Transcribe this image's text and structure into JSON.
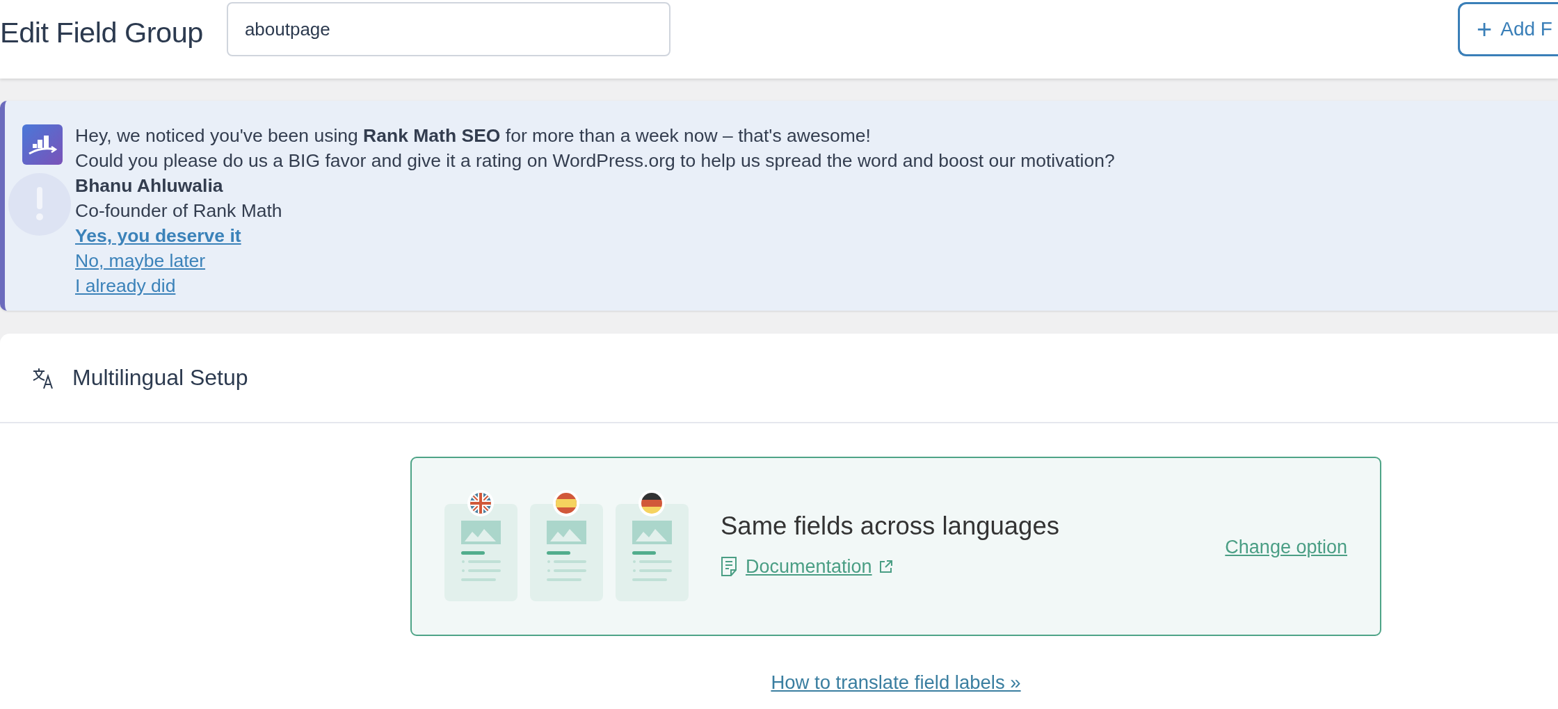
{
  "header": {
    "title": "Edit Field Group",
    "title_field": {
      "value": "aboutpage"
    },
    "add_button": {
      "icon": "+",
      "label": "Add F"
    }
  },
  "notice": {
    "lines": [
      "Hey, we noticed you've been using **Rank Math SEO** for more than a week now – that's awesome!",
      "Could you please do us a BIG favor and give it a rating on WordPress.org to help us spread the word and boost our motivation?"
    ],
    "author": "Bhanu Ahluwalia",
    "role": "Co-founder of Rank Math",
    "links": [
      {
        "label": "Yes, you deserve it",
        "primary": true
      },
      {
        "label": "No, maybe later",
        "primary": false
      },
      {
        "label": "I already did",
        "primary": false
      }
    ]
  },
  "panel": {
    "title": "Multilingual Setup",
    "option_card": {
      "flags": [
        {
          "kind": "uk"
        },
        {
          "kind": "es"
        },
        {
          "kind": "de"
        }
      ],
      "title": "Same fields across languages",
      "doc_link": "Documentation",
      "change_link": "Change option"
    },
    "footer_link": "How to translate field labels »"
  }
}
